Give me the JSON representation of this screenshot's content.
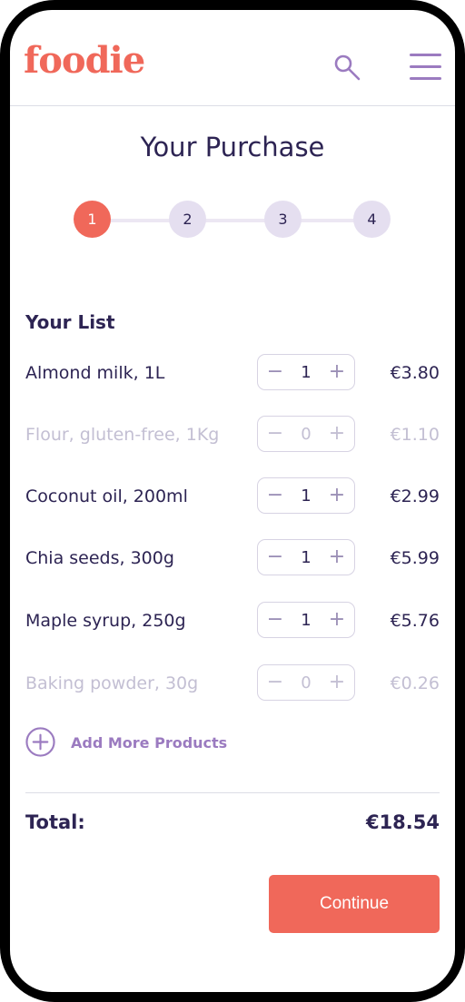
{
  "header": {
    "logo": "foodie",
    "search_icon": "search-icon",
    "menu_icon": "hamburger-menu-icon"
  },
  "page": {
    "title": "Your Purchase"
  },
  "steps": [
    "1",
    "2",
    "3",
    "4"
  ],
  "active_step": "1",
  "list": {
    "title": "Your List",
    "items": [
      {
        "name": "Almond milk, 1L",
        "qty": "1",
        "price": "€3.80",
        "enabled": true
      },
      {
        "name": "Flour, gluten-free, 1Kg",
        "qty": "0",
        "price": "€1.10",
        "enabled": false
      },
      {
        "name": "Coconut oil, 200ml",
        "qty": "1",
        "price": "€2.99",
        "enabled": true
      },
      {
        "name": "Chia seeds, 300g",
        "qty": "1",
        "price": "€5.99",
        "enabled": true
      },
      {
        "name": "Maple syrup, 250g",
        "qty": "1",
        "price": "€5.76",
        "enabled": true
      },
      {
        "name": "Baking powder, 30g",
        "qty": "0",
        "price": "€0.26",
        "enabled": false
      }
    ],
    "add_more_label": "Add More Products",
    "minus_glyph": "−",
    "plus_glyph": "+"
  },
  "total": {
    "label": "Total:",
    "value": "€18.54"
  },
  "actions": {
    "continue_label": "Continue"
  },
  "colors": {
    "accent": "#f0685a",
    "primary_text": "#2d2453",
    "secondary": "#9b7bc0",
    "disabled_text": "#c3bfd3"
  }
}
